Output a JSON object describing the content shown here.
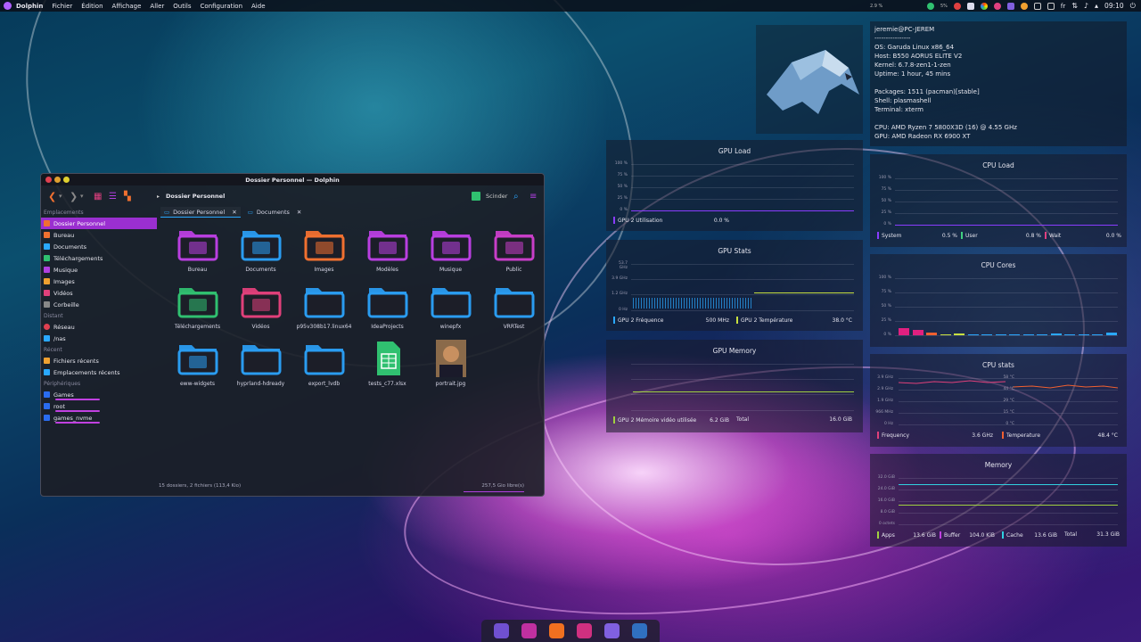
{
  "top_panel": {
    "app_name": "Dolphin",
    "menu": [
      "Fichier",
      "Édition",
      "Affichage",
      "Aller",
      "Outils",
      "Configuration",
      "Aide"
    ],
    "indicator_left": "2.9 %",
    "tray_small": "5%",
    "keyboard_layout": "fr",
    "clock": "09:10"
  },
  "dolphin": {
    "title": "Dossier Personnel — Dolphin",
    "breadcrumb": "Dossier Personnel",
    "split_label": "Scinder",
    "sidebar": {
      "sections": [
        {
          "heading": "Emplacements",
          "items": [
            {
              "label": "Dossier Personnel",
              "icon": "home-icon",
              "active": true
            },
            {
              "label": "Bureau",
              "icon": "desktop-icon"
            },
            {
              "label": "Documents",
              "icon": "documents-icon"
            },
            {
              "label": "Téléchargements",
              "icon": "download-icon"
            },
            {
              "label": "Musique",
              "icon": "music-icon"
            },
            {
              "label": "Images",
              "icon": "images-icon"
            },
            {
              "label": "Vidéos",
              "icon": "videos-icon"
            },
            {
              "label": "Corbeille",
              "icon": "trash-icon"
            }
          ]
        },
        {
          "heading": "Distant",
          "items": [
            {
              "label": "Réseau",
              "icon": "network-icon"
            },
            {
              "label": "/nas",
              "icon": "folder-icon"
            }
          ]
        },
        {
          "heading": "Récent",
          "items": [
            {
              "label": "Fichiers récents",
              "icon": "recent-files-icon"
            },
            {
              "label": "Emplacements récents",
              "icon": "recent-places-icon"
            }
          ]
        },
        {
          "heading": "Périphériques",
          "items": [
            {
              "label": "Games",
              "icon": "drive-icon",
              "usage": 0.85
            },
            {
              "label": "root",
              "icon": "drive-icon",
              "usage": 0.5
            },
            {
              "label": "games_nvme",
              "icon": "drive-icon",
              "usage": 0.4
            }
          ]
        }
      ]
    },
    "tabs": [
      {
        "label": "Dossier Personnel",
        "active": true
      },
      {
        "label": "Documents",
        "active": false
      }
    ],
    "items": [
      {
        "label": "Bureau",
        "kind": "folder",
        "color": "#b93fe0",
        "emblem": "desktop"
      },
      {
        "label": "Documents",
        "kind": "folder",
        "color": "#2a9cf0",
        "emblem": "documents"
      },
      {
        "label": "Images",
        "kind": "folder",
        "color": "#f07030",
        "emblem": "images"
      },
      {
        "label": "Modèles",
        "kind": "folder",
        "color": "#b93fe0",
        "emblem": "templates"
      },
      {
        "label": "Musique",
        "kind": "folder",
        "color": "#b93fe0",
        "emblem": "music"
      },
      {
        "label": "Public",
        "kind": "folder",
        "color": "#c83ec8",
        "emblem": "public"
      },
      {
        "label": "Téléchargements",
        "kind": "folder",
        "color": "#30c070",
        "emblem": "download"
      },
      {
        "label": "Vidéos",
        "kind": "folder",
        "color": "#e0407a",
        "emblem": "videos"
      },
      {
        "label": "p95v308b17.linux64",
        "kind": "folder",
        "color": "#2a9cf0"
      },
      {
        "label": "IdeaProjects",
        "kind": "folder",
        "color": "#2a9cf0"
      },
      {
        "label": "winepfx",
        "kind": "folder",
        "color": "#2a9cf0"
      },
      {
        "label": "VRRTest",
        "kind": "folder",
        "color": "#2a9cf0"
      },
      {
        "label": "eww-widgets",
        "kind": "folder",
        "color": "#2a9cf0",
        "emblem": "preview"
      },
      {
        "label": "hyprland-hdready",
        "kind": "folder",
        "color": "#2a9cf0"
      },
      {
        "label": "export_lvdb",
        "kind": "folder",
        "color": "#2a9cf0"
      },
      {
        "label": "tests_c77.xlsx",
        "kind": "spreadsheet",
        "color": "#30c070"
      },
      {
        "label": "portrait.jpg",
        "kind": "image",
        "color": "#c89060"
      }
    ],
    "status_left": "15 dossiers, 2 fichiers (113,4 Kio)",
    "status_right": "257,5 Gio libre(s)",
    "free_fraction": 0.3
  },
  "sysinfo": {
    "user_host": "jeremie@PC-JEREM",
    "separator": "----------------",
    "os": "OS: Garuda Linux x86_64",
    "host": "Host: B550 AORUS ELITE V2",
    "kernel": "Kernel: 6.7.8-zen1-1-zen",
    "uptime": "Uptime: 1 hour, 45 mins",
    "packages": "Packages: 1511 (pacman)[stable]",
    "shell": "Shell: plasmashell",
    "terminal": "Terminal: xterm",
    "cpu": "CPU: AMD Ryzen 7 5800X3D (16) @ 4.55 GHz",
    "gpu": "GPU: AMD Radeon RX 6900 XT"
  },
  "widgets": {
    "gpu_load": {
      "title": "GPU Load",
      "yticks": [
        "100 %",
        "75 %",
        "50 %",
        "25 %",
        "0 %"
      ],
      "legend": [
        {
          "name": "GPU 2 Utilisation",
          "value": "0.0 %",
          "color": "#8a3cff"
        }
      ]
    },
    "gpu_stats": {
      "title": "GPU Stats",
      "yticks": [
        "53.7 GHz",
        "3.9 GHz",
        "1.2 GHz",
        "0 Hz"
      ],
      "legend": [
        {
          "name": "GPU 2 Fréquence",
          "value": "500 MHz",
          "color": "#2aa8ff"
        },
        {
          "name": "GPU 2 Température",
          "value": "38.0 °C",
          "color": "#c8e040"
        }
      ]
    },
    "gpu_memory": {
      "title": "GPU Memory",
      "legend": [
        {
          "name": "GPU 2 Mémoire vidéo utilisée",
          "value": "6.2 GiB",
          "color": "#a0d040"
        },
        {
          "name": "Total",
          "value": "16.0 GiB",
          "color": ""
        }
      ]
    },
    "cpu_load": {
      "title": "CPU Load",
      "yticks": [
        "100 %",
        "75 %",
        "50 %",
        "25 %",
        "0 %"
      ],
      "legend": [
        {
          "name": "System",
          "value": "0.5 %",
          "color": "#8a3cff"
        },
        {
          "name": "User",
          "value": "0.8 %",
          "color": "#40d080"
        },
        {
          "name": "Wait",
          "value": "0.0 %",
          "color": "#e04080"
        }
      ]
    },
    "cpu_cores": {
      "title": "CPU Cores",
      "yticks": [
        "100 %",
        "75 %",
        "50 %",
        "25 %",
        "0 %"
      ],
      "core_loads": [
        0.12,
        0.1,
        0.04,
        0.0,
        0.03,
        0.0,
        0.0,
        0.0,
        0.0,
        0.0,
        0.0,
        0.03,
        0.02,
        0.0,
        0.0,
        0.04
      ]
    },
    "cpu_stats": {
      "title": "CPU stats",
      "yticks_left": [
        "3.9 GHz",
        "2.9 GHz",
        "1.9 GHz",
        "966 MHz",
        "0 Hz"
      ],
      "yticks_right": [
        "58 °C",
        "44 °C",
        "29 °C",
        "15 °C",
        "0 °C"
      ],
      "legend": [
        {
          "name": "Frequency",
          "value": "3.6 GHz",
          "color": "#e0407a"
        },
        {
          "name": "Temperature",
          "value": "48.4 °C",
          "color": "#f06030"
        }
      ]
    },
    "memory": {
      "title": "Memory",
      "yticks": [
        "32.0 GiB",
        "24.0 GiB",
        "16.0 GiB",
        "8.0 GiB",
        "0 octets"
      ],
      "legend": [
        {
          "name": "Apps",
          "value": "13.6 GiB",
          "color": "#a0d040"
        },
        {
          "name": "Buffer",
          "value": "104.0 KiB",
          "color": "#c040e0"
        },
        {
          "name": "Cache",
          "value": "13.6 GiB",
          "color": "#30d0e0"
        },
        {
          "name": "Total",
          "value": "31.3 GiB",
          "color": ""
        }
      ]
    }
  },
  "dock": {
    "items": [
      {
        "icon": "garuda-icon",
        "color": "#7050d0"
      },
      {
        "icon": "app-icon",
        "color": "#c030a0"
      },
      {
        "icon": "dolphin-icon",
        "color": "#f07020"
      },
      {
        "icon": "media-icon",
        "color": "#d03080"
      },
      {
        "icon": "editor-icon",
        "color": "#8060e0"
      },
      {
        "icon": "assistant-icon",
        "color": "#3070c0"
      }
    ]
  }
}
